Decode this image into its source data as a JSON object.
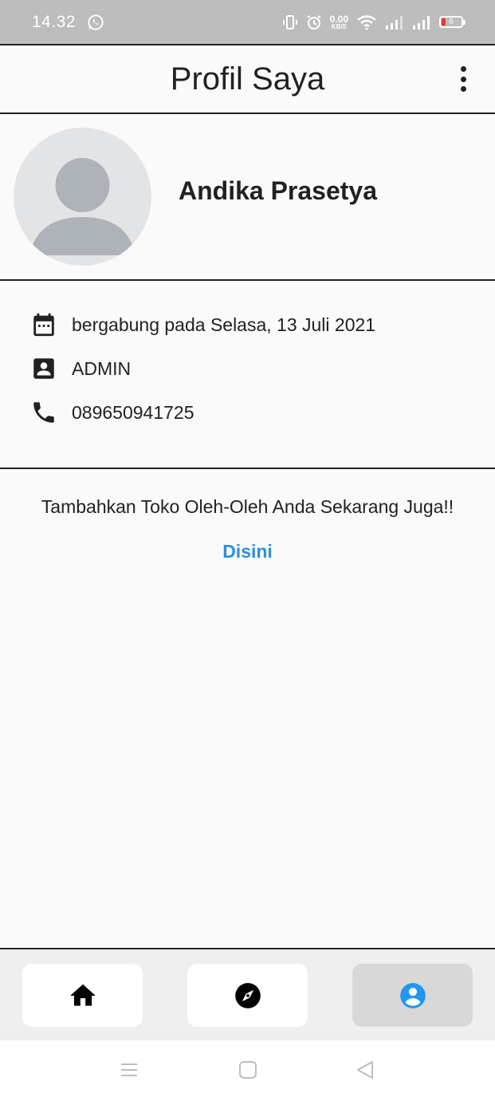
{
  "status_bar": {
    "time": "14.32",
    "net_speed_value": "0.00",
    "net_speed_unit": "KB/S",
    "battery_level": "6",
    "icons": [
      "whatsapp-icon",
      "vibrate-icon",
      "alarm-icon",
      "wifi-icon",
      "signal-icon",
      "signal-icon",
      "battery-icon"
    ]
  },
  "app_bar": {
    "title": "Profil Saya",
    "menu_icon": "more-vertical-icon"
  },
  "profile": {
    "name": "Andika Prasetya",
    "avatar_icon": "default-avatar-icon"
  },
  "info": {
    "joined": "bergabung pada Selasa, 13 Juli 2021",
    "role": "ADMIN",
    "phone": "089650941725"
  },
  "promo": {
    "text": "Tambahkan Toko Oleh-Oleh Anda Sekarang Juga!!",
    "link_label": "Disini"
  },
  "bottom_nav": {
    "items": [
      {
        "name": "home",
        "icon": "home-icon",
        "active": false
      },
      {
        "name": "explore",
        "icon": "compass-icon",
        "active": false
      },
      {
        "name": "profile",
        "icon": "account-circle-icon",
        "active": true
      }
    ],
    "active_color": "#2196f3"
  },
  "colors": {
    "accent_link": "#2f8fd8",
    "status_bar_bg": "#bdbdbd",
    "background": "#fafafa"
  }
}
